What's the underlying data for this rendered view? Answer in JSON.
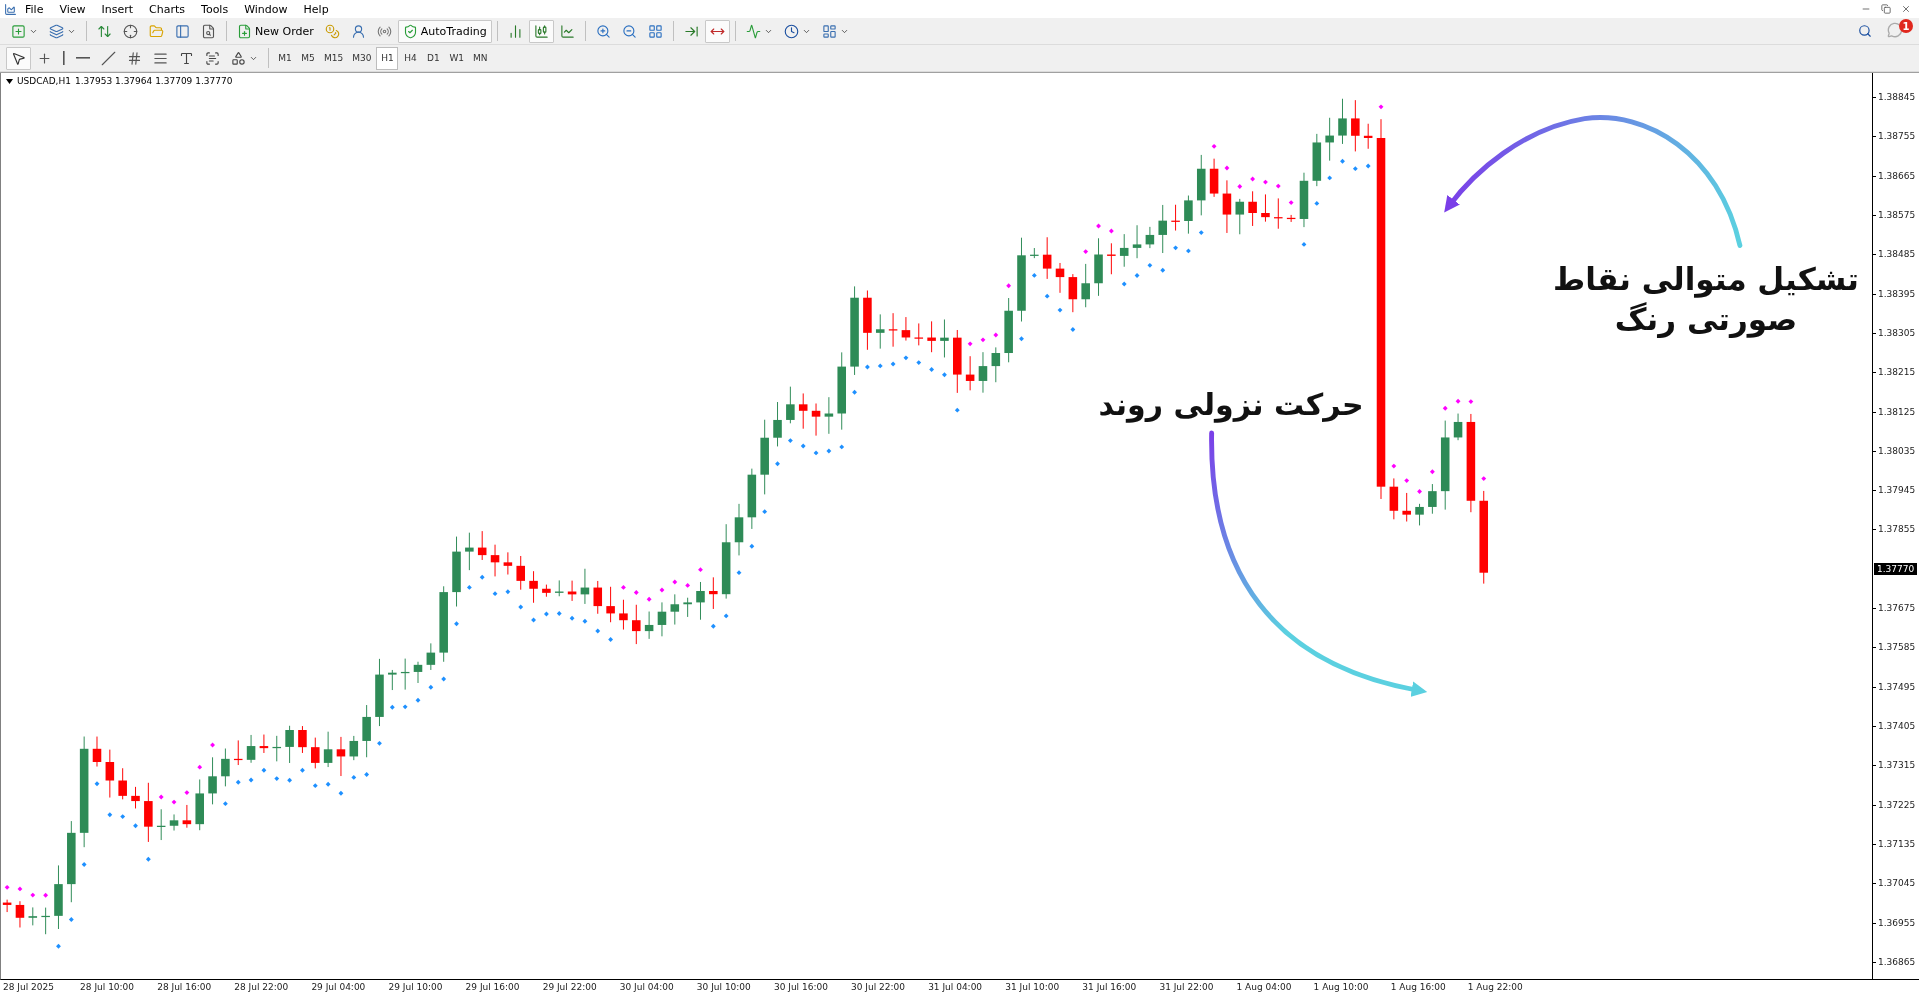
{
  "menu": [
    "File",
    "View",
    "Insert",
    "Charts",
    "Tools",
    "Window",
    "Help"
  ],
  "toolbar": [
    {
      "pressed": false
    },
    {
      "pressed": false
    },
    {
      "pressed": false
    },
    {
      "pressed": false
    },
    {
      "pressed": false
    },
    {
      "pressed": false
    },
    {
      "pressed": false
    },
    {
      "label": "New Order",
      "pressed": false
    },
    {
      "pressed": false
    },
    {
      "pressed": false
    },
    {
      "pressed": false
    },
    {
      "label": "AutoTrading",
      "pressed": true
    },
    {
      "pressed": false
    },
    {
      "pressed": true
    },
    {
      "pressed": false
    },
    {
      "pressed": false
    },
    {
      "pressed": false
    },
    {
      "pressed": false
    },
    {
      "pressed": false
    },
    {
      "pressed": true
    },
    {
      "pressed": false
    },
    {
      "pressed": false
    },
    {
      "pressed": false
    }
  ],
  "notification": {
    "badge": "1"
  },
  "tools": [
    {
      "pressed": true
    },
    {
      "pressed": false
    },
    {
      "pressed": false
    },
    {
      "pressed": false
    },
    {
      "pressed": false
    },
    {
      "pressed": false
    },
    {
      "pressed": false
    },
    {
      "pressed": false
    },
    {
      "pressed": false
    },
    {
      "pressed": false
    }
  ],
  "timeframes": [
    {
      "label": "M1",
      "selected": false
    },
    {
      "label": "M5",
      "selected": false
    },
    {
      "label": "M15",
      "selected": false
    },
    {
      "label": "M30",
      "selected": false
    },
    {
      "label": "H1",
      "selected": true
    },
    {
      "label": "H4",
      "selected": false
    },
    {
      "label": "D1",
      "selected": false
    },
    {
      "label": "W1",
      "selected": false
    },
    {
      "label": "MN",
      "selected": false
    }
  ],
  "chart": {
    "symbol": "USDCAD,H1",
    "ohlc": "1.37953 1.37964 1.37709 1.37770",
    "price_axis": [
      {
        "kind": "tick",
        "label": "1.38845"
      },
      {
        "kind": "tick",
        "label": "1.38755"
      },
      {
        "kind": "tick",
        "label": "1.38665"
      },
      {
        "kind": "tick",
        "label": "1.38575"
      },
      {
        "kind": "tick",
        "label": "1.38485"
      },
      {
        "kind": "tick",
        "label": "1.38395"
      },
      {
        "kind": "tick",
        "label": "1.38305"
      },
      {
        "kind": "tick",
        "label": "1.38215"
      },
      {
        "kind": "tick",
        "label": "1.38125"
      },
      {
        "kind": "tick",
        "label": "1.38035"
      },
      {
        "kind": "tick",
        "label": "1.37945"
      },
      {
        "kind": "tick",
        "label": "1.37855"
      },
      {
        "kind": "current",
        "label": "1.37770"
      },
      {
        "kind": "tick",
        "label": "1.37675"
      },
      {
        "kind": "tick",
        "label": "1.37585"
      },
      {
        "kind": "tick",
        "label": "1.37495"
      },
      {
        "kind": "tick",
        "label": "1.37405"
      },
      {
        "kind": "tick",
        "label": "1.37315"
      },
      {
        "kind": "tick",
        "label": "1.37225"
      },
      {
        "kind": "tick",
        "label": "1.37135"
      },
      {
        "kind": "tick",
        "label": "1.37045"
      },
      {
        "kind": "tick",
        "label": "1.36955"
      },
      {
        "kind": "tick",
        "label": "1.36865"
      }
    ],
    "time_axis": [
      "28 Jul 2025",
      "28 Jul 10:00",
      "28 Jul 16:00",
      "28 Jul 22:00",
      "29 Jul 04:00",
      "29 Jul 10:00",
      "29 Jul 16:00",
      "29 Jul 22:00",
      "30 Jul 04:00",
      "30 Jul 10:00",
      "30 Jul 16:00",
      "30 Jul 22:00",
      "31 Jul 04:00",
      "31 Jul 10:00",
      "31 Jul 16:00",
      "31 Jul 22:00",
      "1 Aug 04:00",
      "1 Aug 10:00",
      "1 Aug 16:00",
      "1 Aug 22:00"
    ]
  },
  "annotations": [
    {
      "kind": "pink-dots",
      "lines": [
        "تشکیل متوالی نقاط",
        "صورتی رنگ"
      ]
    },
    {
      "kind": "downtrend",
      "lines": [
        "حرکت نزولی روند"
      ]
    }
  ]
}
